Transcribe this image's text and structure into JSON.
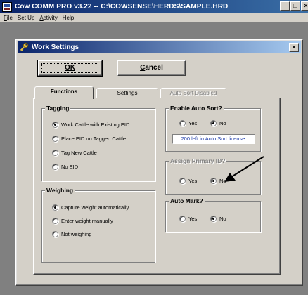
{
  "app": {
    "title": "Cow COMM PRO v3.22 -- C:\\COWSENSE\\HERDS\\SAMPLE.HRD",
    "min_button": "_",
    "max_button": "□",
    "close_button": "×"
  },
  "menu": {
    "items": [
      {
        "label": "File",
        "mnemonic_index": 0
      },
      {
        "label": "Set Up",
        "mnemonic_index": -1
      },
      {
        "label": "Activity",
        "mnemonic_index": 0
      },
      {
        "label": "Help",
        "mnemonic_index": -1
      }
    ]
  },
  "dialog": {
    "title": "Work Settings",
    "close_label": "×",
    "ok_label": "OK",
    "cancel_label": "Cancel",
    "tabs": [
      {
        "label": "Functions",
        "state": "active"
      },
      {
        "label": "Settings",
        "state": "normal"
      },
      {
        "label": "Auto Sort Disabled",
        "state": "disabled"
      }
    ],
    "tagging": {
      "title": "Tagging",
      "options": [
        {
          "label": "Work Cattle with Existing EID",
          "selected": true
        },
        {
          "label": "Place EID on Tagged Cattle",
          "selected": false
        },
        {
          "label": "Tag New Cattle",
          "selected": false
        },
        {
          "label": "No EID",
          "selected": false
        }
      ]
    },
    "weighing": {
      "title": "Weighing",
      "options": [
        {
          "label": "Capture weight automatically",
          "selected": true
        },
        {
          "label": "Enter weight manually",
          "selected": false
        },
        {
          "label": "Not weighing",
          "selected": false
        }
      ]
    },
    "auto_sort": {
      "title": "Enable Auto Sort?",
      "yes_label": "Yes",
      "no_label": "No",
      "selected": "No",
      "license_text": "200 left in Auto Sort license."
    },
    "primary_id": {
      "title": "Assign Primary ID?",
      "yes_label": "Yes",
      "no_label": "No",
      "selected": "No"
    },
    "auto_mark": {
      "title": "Auto Mark?",
      "yes_label": "Yes",
      "no_label": "No",
      "selected": "No"
    }
  },
  "colors": {
    "title_bar": "#0a246a",
    "dialog_face": "#d4d0c8",
    "mdi_background": "#808080",
    "license_text": "#1f3ca8"
  }
}
